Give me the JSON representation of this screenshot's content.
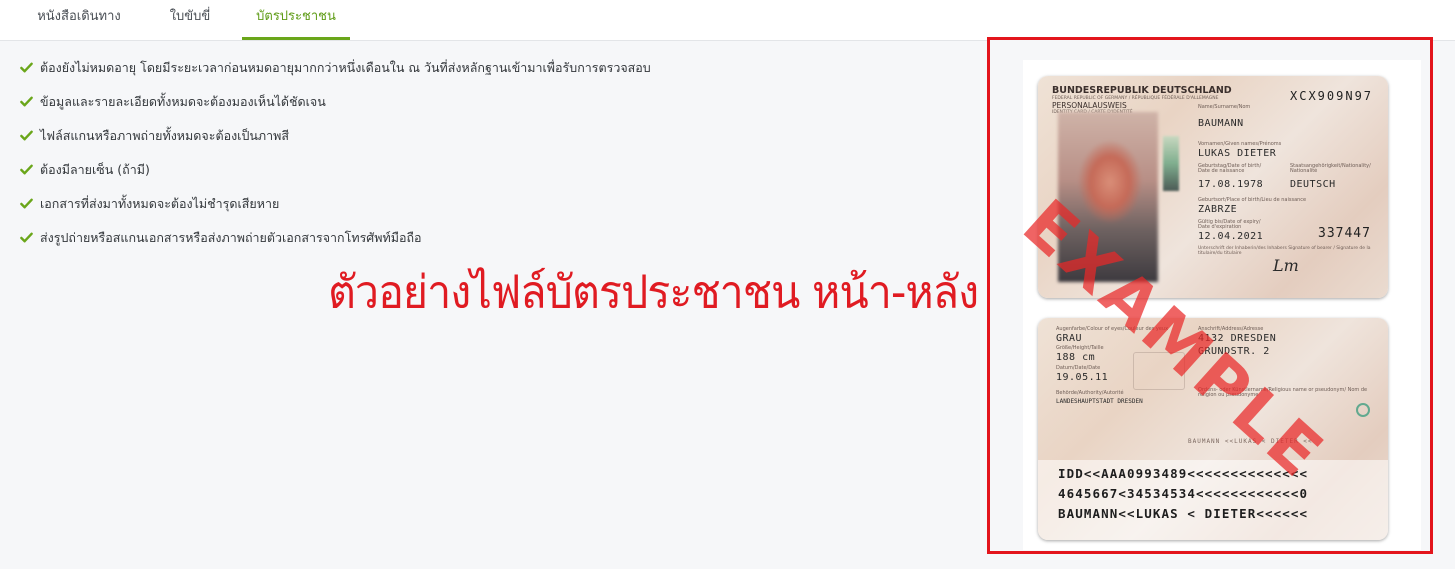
{
  "tabs": [
    {
      "label": "หนังสือเดินทาง",
      "active": false
    },
    {
      "label": "ใบขับขี่",
      "active": false
    },
    {
      "label": "บัตรประชาชน",
      "active": true
    }
  ],
  "requirements": [
    "ต้องยังไม่หมดอายุ โดยมีระยะเวลาก่อนหมดอายุมากกว่าหนึ่งเดือนใน ณ วันที่ส่งหลักฐานเข้ามาเพื่อรับการตรวจสอบ",
    "ข้อมูลและรายละเอียดทั้งหมดจะต้องมองเห็นได้ชัดเจน",
    "ไฟล์สแกนหรือภาพถ่ายทั้งหมดจะต้องเป็นภาพสี",
    "ต้องมีลายเซ็น (ถ้ามี)",
    "เอกสารที่ส่งมาทั้งหมดจะต้องไม่ชำรุดเสียหาย",
    "ส่งรูปถ่ายหรือสแกนเอกสารหรือส่งภาพถ่ายตัวเอกสารจากโทรศัพท์มือถือ"
  ],
  "caption": "ตัวอย่างไฟล์บัตรประชาชน หน้า-หลัง",
  "stamp_text": "EXAMPLE",
  "card_front": {
    "country": "BUNDESREPUBLIK DEUTSCHLAND",
    "country_sub": "FEDERAL REPUBLIC OF GERMANY / RÉPUBLIQUE FÉDÉRALE D'ALLEMAGNE",
    "doc_type": "PERSONALAUSWEIS",
    "doc_sub": "IDENTITY CARD / CARTE D'IDENTITÉ",
    "card_number": "XCX909N97",
    "surname_label": "Name/Surname/Nom",
    "surname": "BAUMANN",
    "given_label": "Vornamen/Given names/Prénoms",
    "given": "LUKAS DIETER",
    "dob_label": "Geburtstag/Date of birth/ Date de naissance",
    "dob": "17.08.1978",
    "nationality_label": "Staatsangehörigkeit/Nationality/ Nationalité",
    "nationality": "DEUTSCH",
    "pob_label": "Geburtsort/Place of birth/Lieu de naissance",
    "pob": "ZABRZE",
    "expiry_label": "Gültig bis/Date of expiry/ Date d'expiration",
    "expiry": "12.04.2021",
    "can": "337447",
    "signature_label": "Unterschrift der Inhaberin/des Inhabers Signature of bearer / Signature de la titulaire/du titulaire",
    "signature": "Lm"
  },
  "card_back": {
    "eyes_label": "Augenfarbe/Colour of eyes/Couleur des yeux",
    "eyes": "GRAU",
    "height_label": "Größe/Height/Taille",
    "height": "188 cm",
    "issue_label": "Datum/Date/Date",
    "issue": "19.05.11",
    "authority_label": "Behörde/Authority/Autorité",
    "authority": "LANDESHAUPTSTADT DRESDEN",
    "address_label": "Anschrift/Address/Adresse",
    "address_line1": "4132 DRESDEN",
    "address_line2": "GRUNDSTR. 2",
    "religious_label": "Ordens- oder Künstlername/Religious name or pseudonym/ Nom de religion ou pseudonyme",
    "strip": "BAUMANN <<LUKAS < DIETER <<",
    "mrz": [
      "IDD<<AAA0993489<<<<<<<<<<<<<<",
      "4645667<34534534<<<<<<<<<<<<0",
      "BAUMANN<<LUKAS < DIETER<<<<<<"
    ]
  },
  "colors": {
    "accent": "#6aa61a",
    "red": "#e3151c",
    "text": "#33373b"
  }
}
